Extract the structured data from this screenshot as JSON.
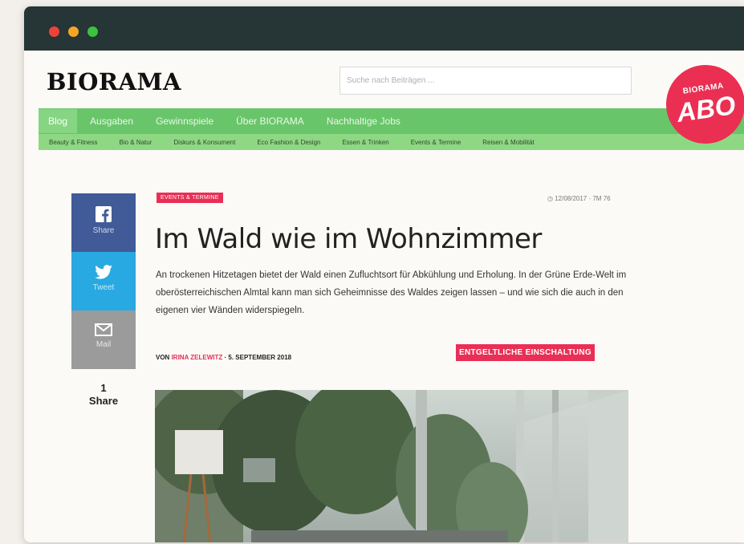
{
  "site": {
    "logo": "BIORAMA",
    "search_placeholder": "Suche nach Beiträgen ..."
  },
  "nav_primary": [
    "Blog",
    "Ausgaben",
    "Gewinnspiele",
    "Über BIORAMA",
    "Nachhaltige Jobs"
  ],
  "nav_secondary": [
    "Beauty & Fitness",
    "Bio & Natur",
    "Diskurs & Konsument",
    "Eco Fashion & Design",
    "Essen & Trinken",
    "Events & Termine",
    "Reisen & Mobilität"
  ],
  "abo_badge": {
    "small": "BIORAMA",
    "big": "ABO"
  },
  "share": {
    "facebook": "Share",
    "twitter": "Tweet",
    "mail": "Mail",
    "count": "1",
    "count_label": "Share"
  },
  "article": {
    "category": "EVENTS & TERMINE",
    "views": "◷ 12/08/2017 · 7M 76",
    "title": "Im Wald wie im Wohnzimmer",
    "lead": "An trockenen Hitzetagen bietet der Wald einen Zufluchtsort für Abkühlung und Erholung. In der Grüne Erde-Welt im oberösterreichischen Almtal kann man sich Geheimnisse des Waldes zeigen lassen – und wie sich die auch in den eigenen vier Wänden widerspiegeln.",
    "byline_prefix": "VON",
    "author": "IRINA ZELEWITZ",
    "date": "· 5. SEPTEMBER 2018",
    "sponsored": "ENTGELTLICHE EINSCHALTUNG"
  },
  "colors": {
    "titlebar": "#263535",
    "nav_green": "#69c56a",
    "subnav_green": "#8ed884",
    "accent_pink": "#e92f56",
    "facebook": "#415a98",
    "twitter": "#28a9e2",
    "mail": "#9b9b9b"
  }
}
